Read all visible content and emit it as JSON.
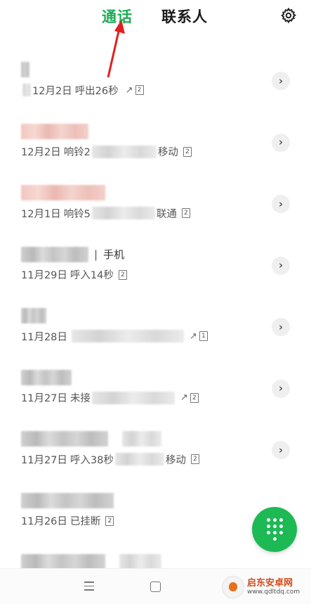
{
  "header": {
    "tabs": [
      {
        "label": "通话",
        "active": true
      },
      {
        "label": "联系人",
        "active": false
      }
    ],
    "settings_icon": "gear-icon"
  },
  "colors": {
    "accent_green": "#1aad53",
    "fab_green": "#1db954",
    "annotation_red": "#e02020"
  },
  "calls": [
    {
      "date": "12月2日",
      "info": "呼出26秒",
      "type_icon": "outgoing-arrow-icon",
      "sim": "2"
    },
    {
      "date": "12月2日",
      "info": "响铃2",
      "suffix": "移动",
      "sim": "2"
    },
    {
      "date": "12月1日",
      "info": "响铃5",
      "suffix": "联通",
      "sim": "2"
    },
    {
      "label": "手机",
      "date": "11月29日",
      "info": "呼入14秒",
      "sim": "2"
    },
    {
      "date": "11月28日",
      "type_icon": "outgoing-arrow-icon",
      "sim": "1"
    },
    {
      "date": "11月27日",
      "info": "未接",
      "type_icon": "outgoing-arrow-icon",
      "sim": "2"
    },
    {
      "date": "11月27日",
      "info": "呼入38秒",
      "suffix": "移动",
      "sim": "2"
    },
    {
      "date": "11月26日",
      "info": "已挂断",
      "sim": "2"
    }
  ],
  "fab": {
    "icon": "dialpad-icon"
  },
  "watermark": {
    "name": "启东安卓网",
    "url": "www.qdltdq.com"
  }
}
